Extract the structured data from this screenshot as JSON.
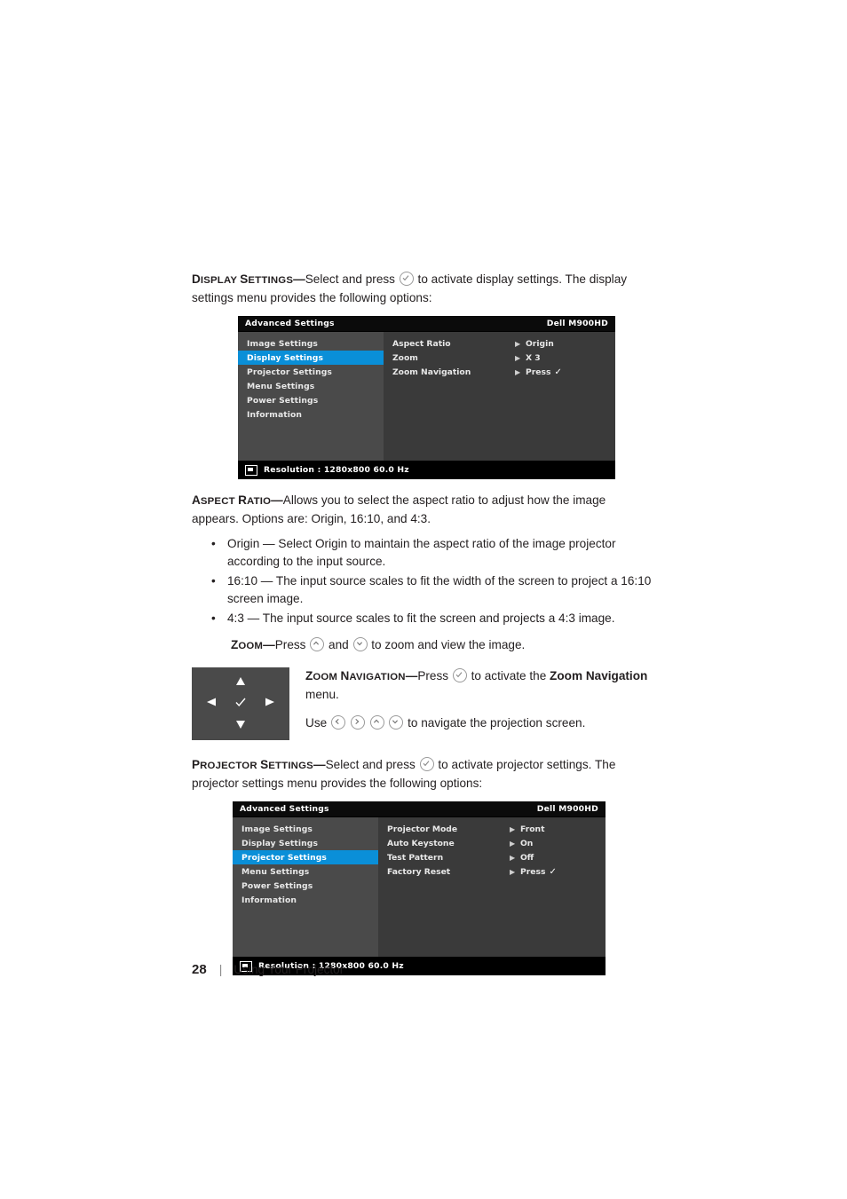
{
  "page": {
    "number": "28",
    "footer_text": "Using Your Projector",
    "divider": "|"
  },
  "display_settings": {
    "term": "D",
    "term_rest": "ISPLAY ",
    "term2": "S",
    "term2_rest": "ETTINGS",
    "dash": "—",
    "text_a": "Select and press",
    "text_b": "to activate display settings. The display settings menu provides the following options:"
  },
  "osd1": {
    "title": "Advanced Settings",
    "model": "Dell M900HD",
    "left_items": [
      "Image Settings",
      "Display Settings",
      "Projector Settings",
      "Menu Settings",
      "Power Settings",
      "Information"
    ],
    "selected_index": 1,
    "right_rows": [
      {
        "label": "Aspect Ratio",
        "arrow": "▶",
        "value": "Origin",
        "check": ""
      },
      {
        "label": "Zoom",
        "arrow": "▶",
        "value": "X 3",
        "check": ""
      },
      {
        "label": "Zoom Navigation",
        "arrow": "▶",
        "value": "Press",
        "check": "✓"
      }
    ],
    "footer": "Resolution :   1280x800 60.0 Hz"
  },
  "aspect_ratio": {
    "term1": "A",
    "term1_rest": "SPECT ",
    "term2": "R",
    "term2_rest": "ATIO",
    "dash": "—",
    "text": "Allows you to select the aspect ratio to adjust how the image appears. Options are: Origin, 16:10, and 4:3.",
    "bullets": [
      "Origin — Select Origin to maintain the aspect ratio of the image projector according to the input source.",
      "16:10 — The input source scales to fit the width of the screen to project a 16:10 screen image.",
      "4:3 — The input source scales to fit the screen and projects a 4:3 image."
    ]
  },
  "zoom": {
    "term1": "Z",
    "term1_rest": "OOM",
    "dash": "—",
    "text_a": "Press",
    "text_and": "and",
    "text_b": "to zoom and view the image."
  },
  "zoom_navigation": {
    "term1": "Z",
    "term1_rest": "OOM ",
    "term2": "N",
    "term2_rest": "AVIGATION",
    "dash": "—",
    "text_a": "Press",
    "text_b": "to activate the",
    "bold1": "Zoom Navigation",
    "text_c": "menu.",
    "use_a": "Use",
    "use_b": "to navigate the projection screen."
  },
  "projector_settings": {
    "term1": "P",
    "term1_rest": "ROJECTOR ",
    "term2": "S",
    "term2_rest": "ETTINGS",
    "dash": "—",
    "text_a": "Select and press",
    "text_b": "to activate projector settings. The projector settings menu provides the following options:"
  },
  "osd2": {
    "title": "Advanced Settings",
    "model": "Dell M900HD",
    "left_items": [
      "Image Settings",
      "Display Settings",
      "Projector Settings",
      "Menu Settings",
      "Power Settings",
      "Information"
    ],
    "selected_index": 2,
    "right_rows": [
      {
        "label": "Projector Mode",
        "arrow": "▶",
        "value": "Front",
        "check": ""
      },
      {
        "label": "Auto Keystone",
        "arrow": "▶",
        "value": "On",
        "check": ""
      },
      {
        "label": "Test Pattern",
        "arrow": "▶",
        "value": "Off",
        "check": ""
      },
      {
        "label": "Factory Reset",
        "arrow": "▶",
        "value": "Press",
        "check": "✓"
      }
    ],
    "footer": "Resolution :   1280x800 60.0 Hz"
  },
  "icons": {
    "check": "check-circle-icon",
    "up": "chevron-up-circle-icon",
    "down": "chevron-down-circle-icon",
    "left": "chevron-left-circle-icon",
    "right": "chevron-right-circle-icon"
  }
}
